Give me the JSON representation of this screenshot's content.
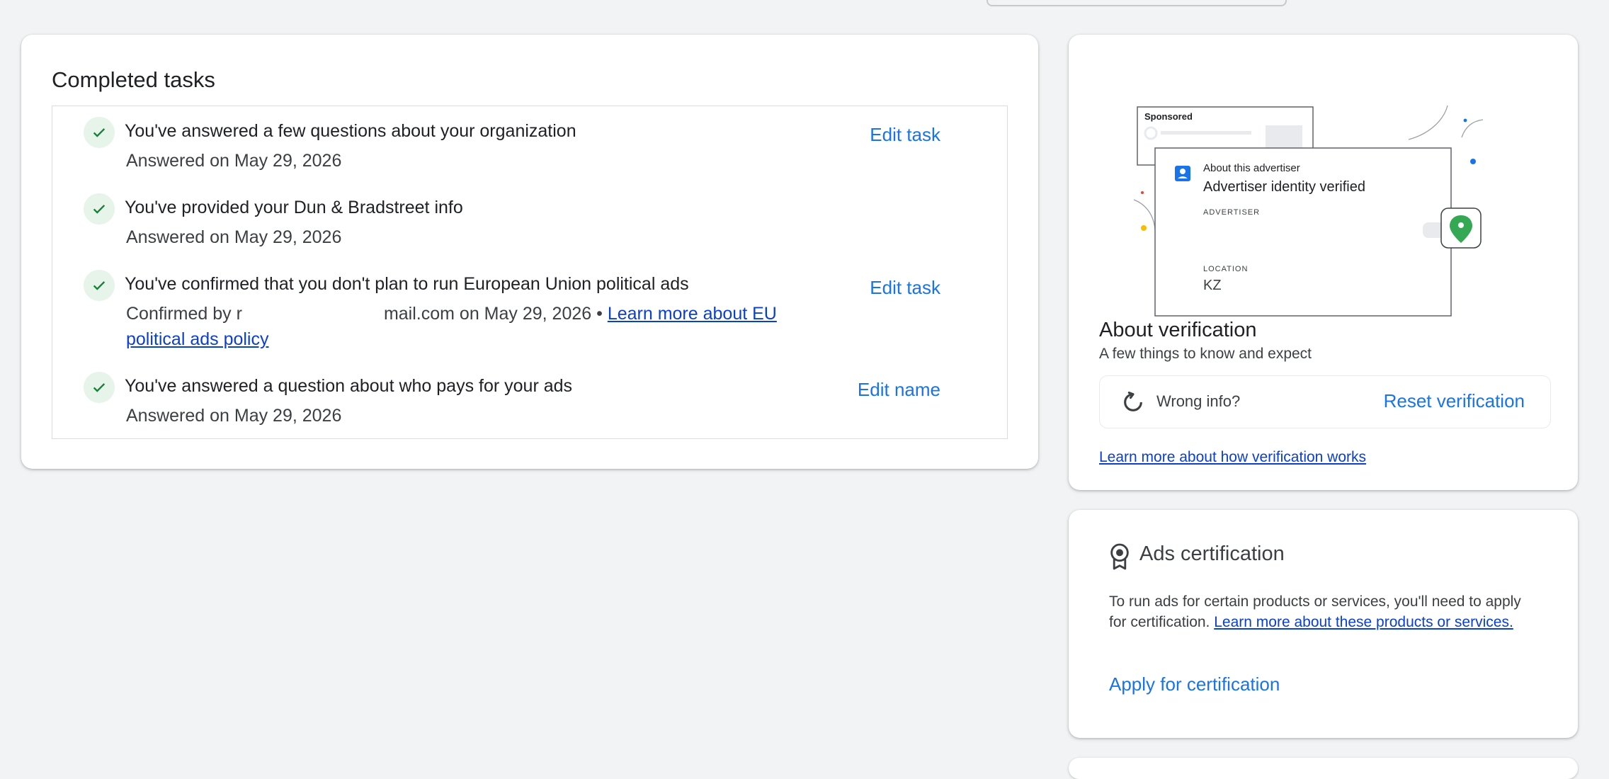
{
  "completed_tasks": {
    "title": "Completed tasks",
    "items": [
      {
        "title": "You've answered a few questions about your organization",
        "subtitle": "Answered on May 29, 2026",
        "action": "Edit task"
      },
      {
        "title": "You've provided your Dun & Bradstreet info",
        "subtitle": "Answered on May 29, 2026",
        "action": ""
      },
      {
        "title": "You've confirmed that you don't plan to run European Union political ads",
        "subtitle_prefix": "Confirmed by r",
        "subtitle_middle": "mail.com on May 29, 2026 •",
        "subtitle_link": "Learn more about EU political ads policy",
        "action": "Edit task"
      },
      {
        "title": "You've answered a question about who pays for your ads",
        "subtitle": "Answered on May 29, 2026",
        "action": "Edit name"
      }
    ]
  },
  "verification": {
    "illustration": {
      "sponsored": "Sponsored",
      "about_label": "About this advertiser",
      "verified_title": "Advertiser identity verified",
      "advertiser_label": "ADVERTISER",
      "location_label": "LOCATION",
      "location_value": "KZ"
    },
    "title": "About verification",
    "subtitle": "A few things to know and expect",
    "wrong_info_label": "Wrong info?",
    "reset_button": "Reset verification",
    "learn_more_link": "Learn more about how verification works"
  },
  "certification": {
    "title": "Ads certification",
    "body": "To run ads for certain products or services, you'll need to apply for certification.",
    "body_link": "Learn more about these products or services.",
    "apply_button": "Apply for certification"
  },
  "colors": {
    "accent": "#1a73e8",
    "check_bg": "#e6f4ea",
    "check": "#188038",
    "link": "#0b3fcc",
    "page_bg": "#f1f3f4"
  },
  "icons": [
    "check-icon",
    "refresh-icon",
    "badge-icon",
    "person-card-icon",
    "location-pin-icon"
  ]
}
